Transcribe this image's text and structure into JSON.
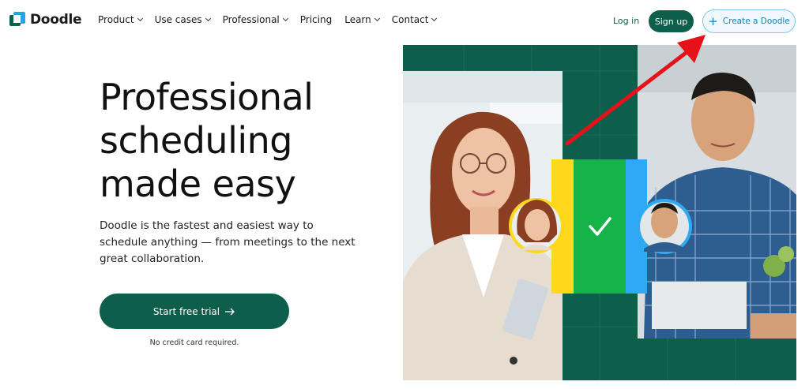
{
  "brand": {
    "name": "Doodle"
  },
  "nav": {
    "items": [
      {
        "label": "Product",
        "has_dropdown": true
      },
      {
        "label": "Use cases",
        "has_dropdown": true
      },
      {
        "label": "Professional",
        "has_dropdown": true
      },
      {
        "label": "Pricing",
        "has_dropdown": false
      },
      {
        "label": "Learn",
        "has_dropdown": true
      },
      {
        "label": "Contact",
        "has_dropdown": true
      }
    ],
    "login_label": "Log in",
    "signup_label": "Sign up",
    "create_label": "Create a Doodle",
    "create_icon": "plus-icon"
  },
  "hero": {
    "title_lines": [
      "Professional",
      "scheduling",
      "made easy"
    ],
    "subtitle": "Doodle is the fastest and easiest way to schedule anything — from meetings to the next great collaboration.",
    "cta_label": "Start free trial",
    "cta_icon": "arrow-right-icon",
    "cta_note": "No credit card required."
  },
  "colors": {
    "brand_green": "#0e5e4c",
    "brand_blue": "#1da7e5",
    "accent_yellow": "#ffd81c",
    "accent_green": "#16b34a",
    "accent_blue": "#30a9f4",
    "annotation_red": "#e8111a"
  }
}
